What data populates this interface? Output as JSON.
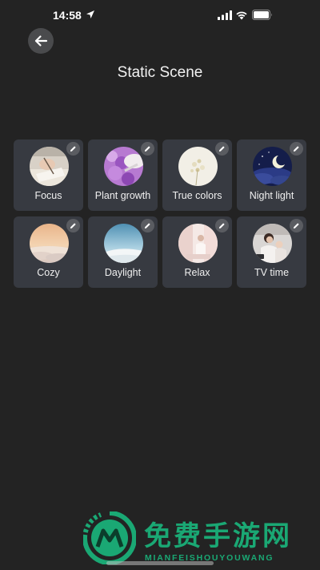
{
  "status_bar": {
    "time": "14:58"
  },
  "header": {
    "title": "Static Scene"
  },
  "scenes": [
    {
      "label": "Focus"
    },
    {
      "label": "Plant growth"
    },
    {
      "label": "True colors"
    },
    {
      "label": "Night light"
    },
    {
      "label": "Cozy"
    },
    {
      "label": "Daylight"
    },
    {
      "label": "Relax"
    },
    {
      "label": "TV time"
    }
  ],
  "watermark": {
    "title": "免费手游网",
    "subtitle": "MIANFEISHOUYOUWANG"
  },
  "colors": {
    "background": "#232323",
    "card": "#373a41",
    "watermark": "#1aa874"
  }
}
